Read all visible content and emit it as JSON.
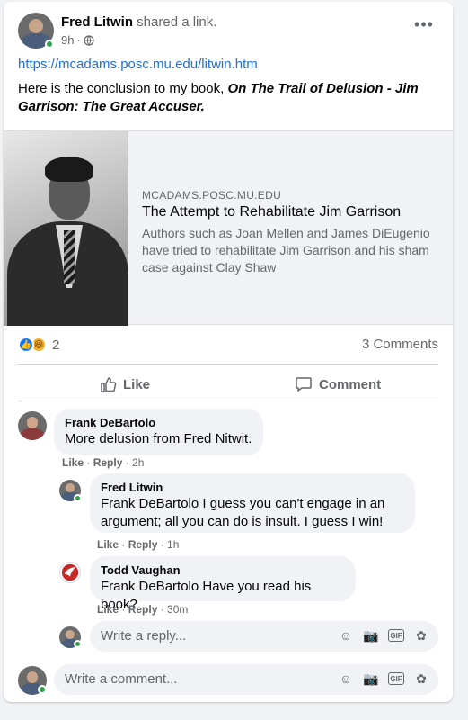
{
  "post": {
    "author": "Fred Litwin",
    "action": "shared a link.",
    "time": "9h",
    "privacy_icon": "globe-icon",
    "link_url": "https://mcadams.posc.mu.edu/litwin.htm",
    "text_prefix": "Here is the conclusion to my book, ",
    "text_book": "On The Trail of Delusion - Jim Garrison: The Great Accuser."
  },
  "preview": {
    "domain": "MCADAMS.POSC.MU.EDU",
    "title": "The Attempt to Rehabilitate Jim Garrison",
    "description": "Authors such as Joan Mellen and James DiEugenio have tried to rehabilitate Jim Garrison and his sham case against Clay Shaw"
  },
  "stats": {
    "reaction_count": "2",
    "comments_label": "3 Comments"
  },
  "actions": {
    "like": "Like",
    "comment": "Comment"
  },
  "comments": [
    {
      "name": "Frank DeBartolo",
      "mention": "",
      "text": "More delusion from Fred Nitwit.",
      "like": "Like",
      "reply": "Reply",
      "time": "2h"
    }
  ],
  "replies": [
    {
      "name": "Fred Litwin",
      "mention": "Frank DeBartolo",
      "text": " I guess you can't engage in an argument; all you can do is insult. I guess I win!",
      "like": "Like",
      "reply": "Reply",
      "time": "1h"
    },
    {
      "name": "Todd Vaughan",
      "mention": "Frank DeBartolo",
      "text": " Have you read his book?",
      "like": "Like",
      "reply": "Reply",
      "time": "30m"
    }
  ],
  "composers": {
    "reply_placeholder": "Write a reply...",
    "comment_placeholder": "Write a comment..."
  },
  "colors": {
    "accent": "#1877f2",
    "link": "#216fdb",
    "online": "#31a24c",
    "muted": "#65676b"
  }
}
